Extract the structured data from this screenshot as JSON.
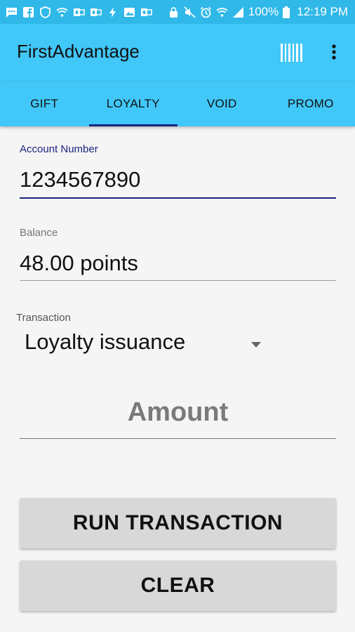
{
  "status_bar": {
    "battery": "100%",
    "time": "12:19 PM",
    "left_icons": [
      "chat-icon",
      "facebook-icon",
      "shield-icon",
      "wifi-icon",
      "outlook-icon",
      "outlook-icon",
      "bolt-icon",
      "image-icon",
      "outlook-icon"
    ],
    "right_icons": [
      "lock-icon",
      "mute-icon",
      "alarm-icon",
      "wifi-icon",
      "signal-icon",
      "battery-icon"
    ]
  },
  "app_bar": {
    "title": "FirstAdvantage",
    "color": "#41c7f8"
  },
  "tabs": [
    "GIFT",
    "LOYALTY",
    "VOID",
    "PROMO"
  ],
  "active_tab": "LOYALTY",
  "form": {
    "account_label": "Account Number",
    "account_value": "1234567890",
    "balance_label": "Balance",
    "balance_value": "48.00 points",
    "transaction_label": "Transaction",
    "transaction_value": "Loyalty issuance",
    "amount_placeholder": "Amount"
  },
  "buttons": {
    "run": "RUN TRANSACTION",
    "clear": "CLEAR"
  },
  "colors": {
    "accent": "#1a237e",
    "status_bar": "#2fb8e8"
  }
}
